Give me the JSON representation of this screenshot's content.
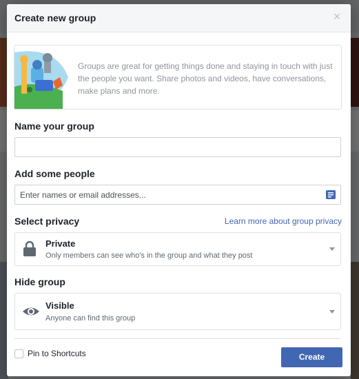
{
  "dialog": {
    "title": "Create new group",
    "close_symbol": "×",
    "intro_text": "Groups are great for getting things done and staying in touch with just the people you want. Share photos and videos, have conversations, make plans and more.",
    "name_label": "Name your group",
    "name_value": "",
    "people_label": "Add some people",
    "people_placeholder": "Enter names or email addresses...",
    "privacy_label": "Select privacy",
    "privacy_link": "Learn more about group privacy",
    "privacy": {
      "title": "Private",
      "subtitle": "Only members can see who's in the group and what they post",
      "icon": "lock-icon"
    },
    "hide_label": "Hide group",
    "visibility": {
      "title": "Visible",
      "subtitle": "Anyone can find this group",
      "icon": "eye-icon"
    },
    "pin_label": "Pin to Shortcuts",
    "pin_checked": false,
    "create_label": "Create",
    "accent_color": "#4267b2"
  }
}
